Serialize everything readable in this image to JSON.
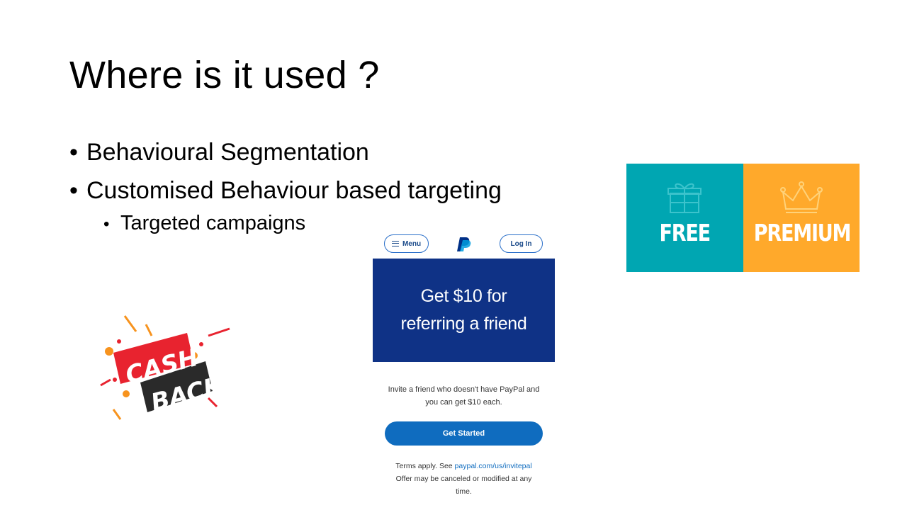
{
  "slide": {
    "title": "Where is it used ?",
    "bullets": [
      {
        "marker": "•",
        "text": "Behavioural Segmentation"
      },
      {
        "marker": "•",
        "text": "Customised Behaviour based targeting"
      },
      {
        "marker": "•",
        "text": "Targeted campaigns"
      }
    ]
  },
  "plans": {
    "free": {
      "label": "FREE",
      "icon": "gift-icon",
      "color": "#00a6b2"
    },
    "premium": {
      "label": "PREMIUM",
      "icon": "crown-icon",
      "color": "#ffa92b"
    }
  },
  "cashback": {
    "line1": "CASH",
    "line2": "BACK",
    "colors": {
      "red": "#e8232f",
      "dark": "#2a2a2a",
      "orange": "#f7931e"
    }
  },
  "paypal": {
    "menu_label": "Menu",
    "login_label": "Log In",
    "logo": "paypal-logo",
    "hero_line1": "Get $10 for",
    "hero_line2": "referring a friend",
    "invite_line1": "Invite a friend who doesn't have PayPal and",
    "invite_line2": "you can get $10 each.",
    "cta_label": "Get Started",
    "terms_prefix": "Terms apply. See ",
    "terms_link": "paypal.com/us/invitepal",
    "terms_line2": "Offer may be canceled or modified at any",
    "terms_line3": "time.",
    "colors": {
      "hero_bg": "#0f3286",
      "button": "#0f6cbf"
    }
  }
}
